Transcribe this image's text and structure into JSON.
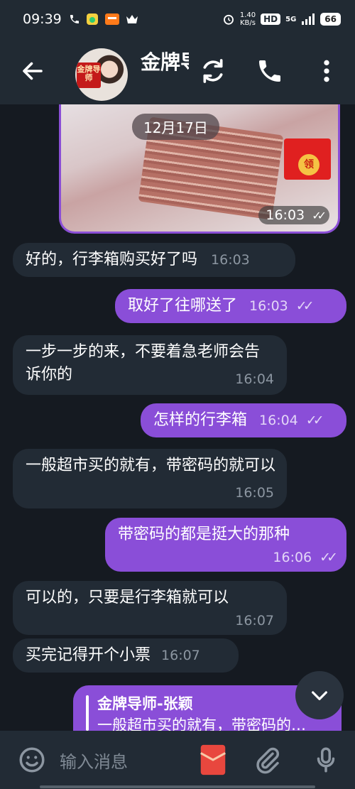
{
  "status_bar": {
    "time": "09:39",
    "net_speed_value": "1.40",
    "net_speed_unit": "KB/s",
    "hd_label": "HD",
    "signal_label": "5G",
    "battery": "66"
  },
  "header": {
    "title": "金牌导",
    "avatar_badge": "金牌导师"
  },
  "date_chip": "12月17日",
  "photo": {
    "time": "16:03",
    "redpacket_label": "领"
  },
  "messages": [
    {
      "dir": "in",
      "text": "好的，行李箱购买好了吗",
      "time": "16:03"
    },
    {
      "dir": "out",
      "text": "取好了往哪送了",
      "time": "16:03"
    },
    {
      "dir": "in",
      "text": "一步一步的来，不要着急老师会告诉你的",
      "time": "16:04"
    },
    {
      "dir": "out",
      "text": "怎样的行李箱",
      "time": "16:04"
    },
    {
      "dir": "in",
      "text": "一般超市买的就有，带密码的就可以",
      "time": "16:05"
    },
    {
      "dir": "out",
      "text": "带密码的都是挺大的那种",
      "time": "16:06"
    },
    {
      "dir": "in",
      "text": "可以的，只要是行李箱就可以",
      "time": "16:07"
    },
    {
      "dir": "in",
      "text": "买完记得开个小票",
      "time": "16:07"
    }
  ],
  "reply_preview": {
    "name": "金牌导师-张颖",
    "text": "一般超市买的就有，带密码的…"
  },
  "composer": {
    "placeholder": "输入消息"
  },
  "colors": {
    "background": "#151a21",
    "bar": "#212a33",
    "incoming": "#222b35",
    "outgoing": "#8a4ed8"
  }
}
